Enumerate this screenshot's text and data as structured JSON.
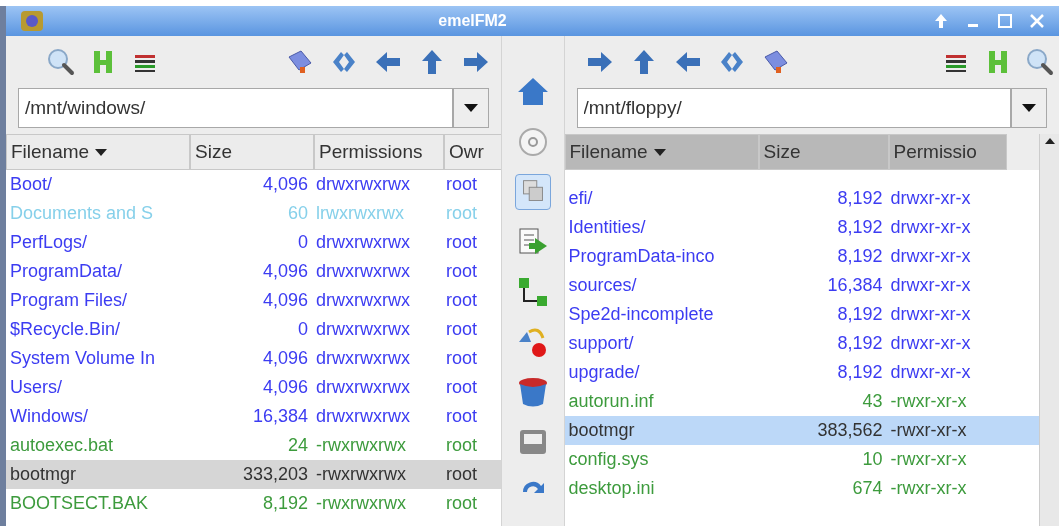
{
  "window": {
    "title": "emelFM2"
  },
  "panes": [
    {
      "path": "/mnt/windows/",
      "active": false,
      "columns": [
        {
          "label": "Filename",
          "sorted": true
        },
        {
          "label": "Size",
          "sorted": false
        },
        {
          "label": "Permissions",
          "sorted": false
        },
        {
          "label": "Owr",
          "sorted": false
        }
      ],
      "rows": [
        {
          "kind": "dir",
          "name": "Boot/",
          "size": "4,096",
          "permissions": "drwxrwxrwx",
          "owner": "root",
          "selected": false
        },
        {
          "kind": "link",
          "name": "Documents and S",
          "size": "60",
          "permissions": "lrwxrwxrwx",
          "owner": "root",
          "selected": false
        },
        {
          "kind": "dir",
          "name": "PerfLogs/",
          "size": "0",
          "permissions": "drwxrwxrwx",
          "owner": "root",
          "selected": false
        },
        {
          "kind": "dir",
          "name": "ProgramData/",
          "size": "4,096",
          "permissions": "drwxrwxrwx",
          "owner": "root",
          "selected": false
        },
        {
          "kind": "dir",
          "name": "Program Files/",
          "size": "4,096",
          "permissions": "drwxrwxrwx",
          "owner": "root",
          "selected": false
        },
        {
          "kind": "dir",
          "name": "$Recycle.Bin/",
          "size": "0",
          "permissions": "drwxrwxrwx",
          "owner": "root",
          "selected": false
        },
        {
          "kind": "dir",
          "name": "System Volume In",
          "size": "4,096",
          "permissions": "drwxrwxrwx",
          "owner": "root",
          "selected": false
        },
        {
          "kind": "dir",
          "name": "Users/",
          "size": "4,096",
          "permissions": "drwxrwxrwx",
          "owner": "root",
          "selected": false
        },
        {
          "kind": "dir",
          "name": "Windows/",
          "size": "16,384",
          "permissions": "drwxrwxrwx",
          "owner": "root",
          "selected": false
        },
        {
          "kind": "file",
          "name": "autoexec.bat",
          "size": "24",
          "permissions": "-rwxrwxrwx",
          "owner": "root",
          "selected": false
        },
        {
          "kind": "file",
          "name": "bootmgr",
          "size": "333,203",
          "permissions": "-rwxrwxrwx",
          "owner": "root",
          "selected": true
        },
        {
          "kind": "file",
          "name": "BOOTSECT.BAK",
          "size": "8,192",
          "permissions": "-rwxrwxrwx",
          "owner": "root",
          "selected": false
        }
      ]
    },
    {
      "path": "/mnt/floppy/",
      "active": true,
      "columns": [
        {
          "label": "Filename",
          "sorted": true
        },
        {
          "label": "Size",
          "sorted": false
        },
        {
          "label": "Permissio",
          "sorted": false
        }
      ],
      "rows": [
        {
          "kind": "dir",
          "name": "efi/",
          "size": "8,192",
          "permissions": "drwxr-xr-x",
          "selected": false
        },
        {
          "kind": "dir",
          "name": "Identities/",
          "size": "8,192",
          "permissions": "drwxr-xr-x",
          "selected": false
        },
        {
          "kind": "dir",
          "name": "ProgramData-inco",
          "size": "8,192",
          "permissions": "drwxr-xr-x",
          "selected": false
        },
        {
          "kind": "dir",
          "name": "sources/",
          "size": "16,384",
          "permissions": "drwxr-xr-x",
          "selected": false
        },
        {
          "kind": "dir",
          "name": "Spe2d-incomplete",
          "size": "8,192",
          "permissions": "drwxr-xr-x",
          "selected": false
        },
        {
          "kind": "dir",
          "name": "support/",
          "size": "8,192",
          "permissions": "drwxr-xr-x",
          "selected": false
        },
        {
          "kind": "dir",
          "name": "upgrade/",
          "size": "8,192",
          "permissions": "drwxr-xr-x",
          "selected": false
        },
        {
          "kind": "file",
          "name": "autorun.inf",
          "size": "43",
          "permissions": "-rwxr-xr-x",
          "selected": false
        },
        {
          "kind": "file",
          "name": "bootmgr",
          "size": "383,562",
          "permissions": "-rwxr-xr-x",
          "selected": true
        },
        {
          "kind": "file",
          "name": "config.sys",
          "size": "10",
          "permissions": "-rwxr-xr-x",
          "selected": false
        },
        {
          "kind": "file",
          "name": "desktop.ini",
          "size": "674",
          "permissions": "-rwxr-xr-x",
          "selected": false
        }
      ]
    }
  ]
}
